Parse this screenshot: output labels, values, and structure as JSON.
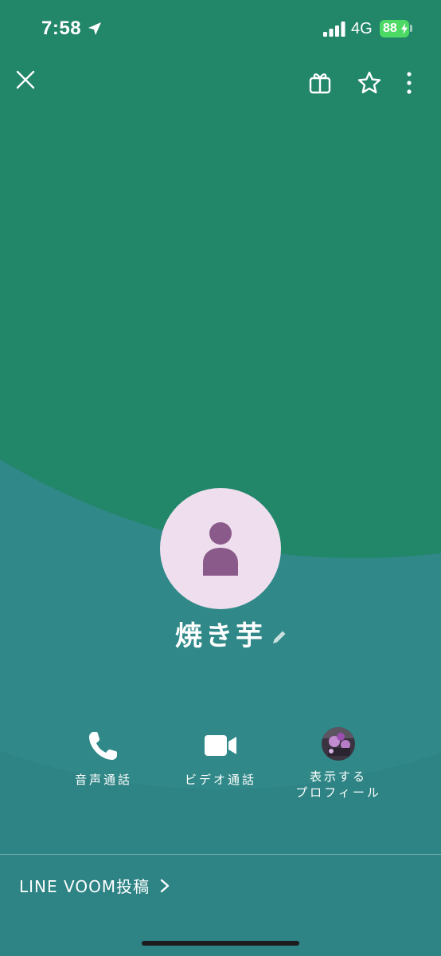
{
  "status_bar": {
    "time": "7:58",
    "network": "4G",
    "battery": "88"
  },
  "top_bar": {
    "icons": [
      "close-icon",
      "gift-icon",
      "star-icon",
      "more-vertical-icon"
    ]
  },
  "profile": {
    "name": "焼き芋",
    "avatar_icon": "person-icon",
    "avatar_bg": "#efdfee",
    "avatar_fg": "#8a5a8a"
  },
  "actions": [
    {
      "label": "音声通話",
      "icon": "phone-icon"
    },
    {
      "label": "ビデオ通話",
      "icon": "video-camera-icon"
    },
    {
      "label_line1": "表示する",
      "label_line2": "プロフィール",
      "icon": "profile-thumbnail"
    }
  ],
  "footer": {
    "voom_label": "LINE VOOM投稿"
  },
  "colors": {
    "background_green": "#228669",
    "background_teal": "#2e8385",
    "battery_green": "#4cd964"
  }
}
